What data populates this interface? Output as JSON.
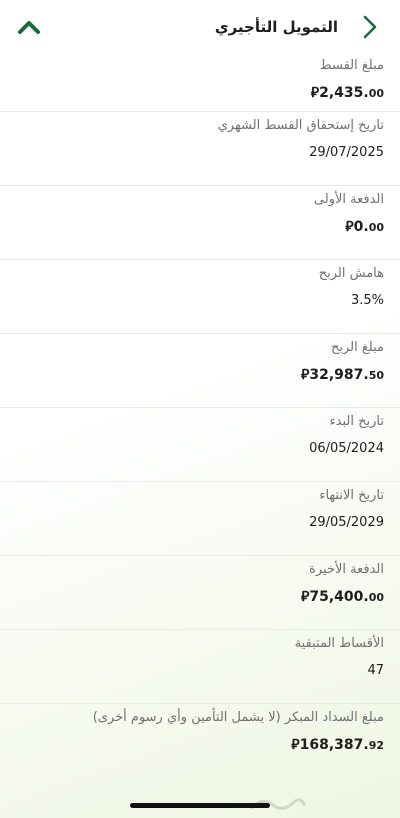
{
  "header": {
    "title": "التمويل التأجيري"
  },
  "currency_symbol": "⃁",
  "items": [
    {
      "label": "مبلغ القسط",
      "int": "2,435.",
      "dec": "00",
      "currency": true
    },
    {
      "label": "تاريخ إستحقاق القسط الشهري",
      "text": "29/07/2025"
    },
    {
      "label": "الدفعة الأولى",
      "int": "0.",
      "dec": "00",
      "currency": true
    },
    {
      "label": "هامش الربح",
      "text": "3.5%"
    },
    {
      "label": "مبلغ الربح",
      "int": "32,987.",
      "dec": "50",
      "currency": true
    },
    {
      "label": "تاريخ البدء",
      "text": "06/05/2024"
    },
    {
      "label": "تاريخ الانتهاء",
      "text": "29/05/2029"
    },
    {
      "label": "الدفعة الأخيرة",
      "int": "75,400.",
      "dec": "00",
      "currency": true
    },
    {
      "label": "الأقساط المتبقية",
      "text": "47"
    },
    {
      "label": "مبلغ السداد المبكر (لا يشمل التأمين وأي رسوم أخرى)",
      "int": "168,387.",
      "dec": "92",
      "currency": true
    }
  ],
  "colors": {
    "accent": "#1b6b3a",
    "gradient_tint": "#eef6e2"
  },
  "icons": {
    "back": "chevron-right-icon",
    "collapse": "chevron-up-icon"
  }
}
